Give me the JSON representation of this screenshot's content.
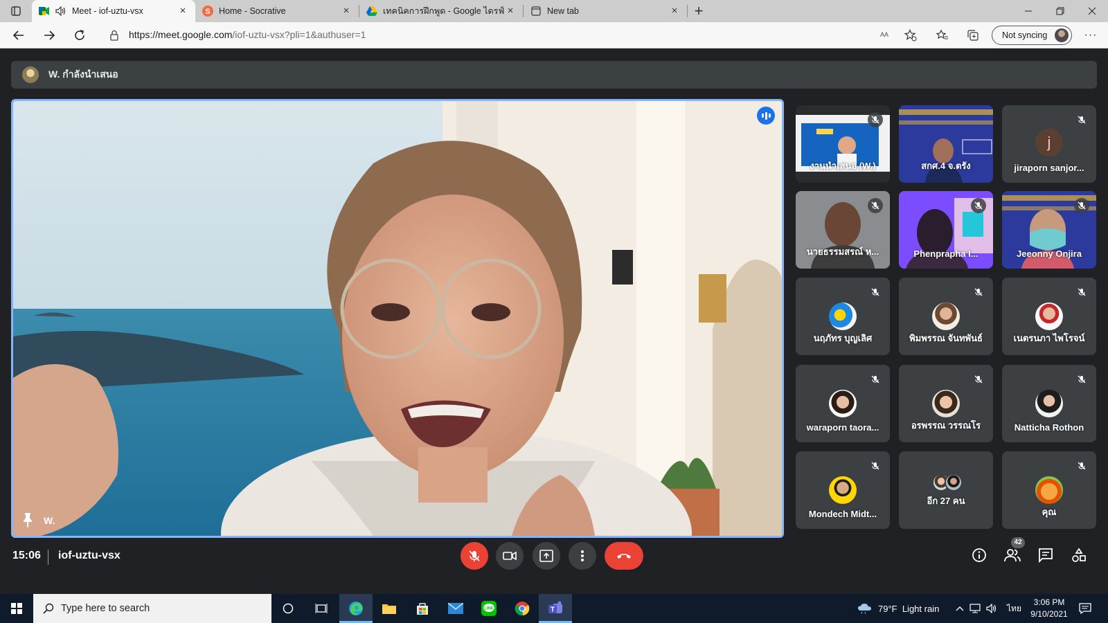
{
  "browser": {
    "tabs": [
      {
        "label": "Meet - iof-uztu-vsx",
        "active": true
      },
      {
        "label": "Home - Socrative",
        "active": false
      },
      {
        "label": "เทคนิคการฝึกพูด - Google ไดรฟ์",
        "active": false
      },
      {
        "label": "New tab",
        "active": false
      }
    ],
    "address": {
      "host": "https://meet.google.com",
      "path": "/iof-uztu-vsx?pli=1&authuser=1"
    },
    "sync_label": "Not syncing"
  },
  "meet": {
    "presenting_banner": "W. กำลังนำเสนอ",
    "main_speaker": "W.",
    "tiles": [
      {
        "name": "งานนำเสนอ (W.)",
        "muted": true
      },
      {
        "name": "สกศ.4 จ.ตรัง",
        "muted": false
      },
      {
        "name": "jiraporn sanjor...",
        "muted": true,
        "initial": "j"
      },
      {
        "name": "นายธรรมสรณ์ ห...",
        "muted": true
      },
      {
        "name": "Phenprapha I...",
        "muted": true
      },
      {
        "name": "Jeeonny Onjira",
        "muted": true
      },
      {
        "name": "นฤภัทร บุญเลิศ",
        "muted": true
      },
      {
        "name": "พิมพรรณ จันทพันธ์",
        "muted": true
      },
      {
        "name": "เนตรนภา ไพโรจน์",
        "muted": true
      },
      {
        "name": "waraporn taora...",
        "muted": true
      },
      {
        "name": "อรพรรณ วรรณโร",
        "muted": true
      },
      {
        "name": "Natticha Rothon",
        "muted": true
      },
      {
        "name": "Mondech Midt...",
        "muted": true
      },
      {
        "name": "อีก 27 คน",
        "muted": false
      },
      {
        "name": "คุณ",
        "muted": true
      }
    ],
    "time": "15:06",
    "meeting_code": "iof-uztu-vsx",
    "participant_count": "42"
  },
  "taskbar": {
    "search_placeholder": "Type here to search",
    "weather": "79°F  Light rain",
    "language": "ไทย",
    "time": "3:06 PM",
    "date": "9/10/2021"
  },
  "colors": {
    "meet_bg": "#202124",
    "tile_bg": "#3c4043",
    "speaker_border": "#8ab4f8",
    "end_call": "#ea4335",
    "taskbar": "#0f1a2b"
  }
}
